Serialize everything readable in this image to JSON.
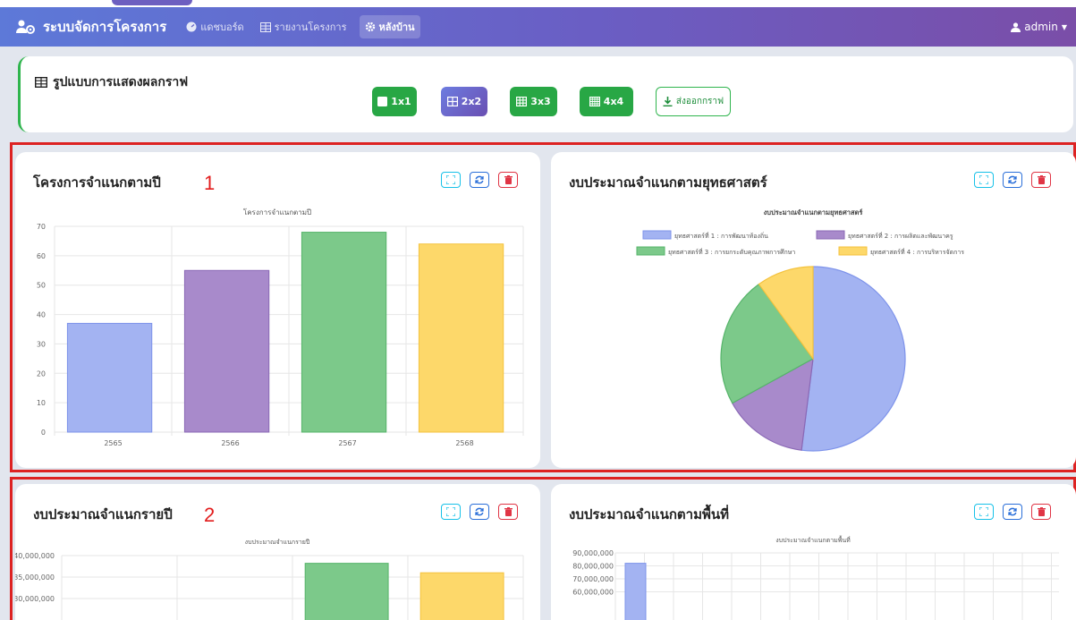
{
  "nav": {
    "brand": "ระบบจัดการโครงการ",
    "items": [
      {
        "label": "แดชบอร์ด",
        "icon": "dashboard-icon"
      },
      {
        "label": "รายงานโครงการ",
        "icon": "table-icon"
      },
      {
        "label": "หลังบ้าน",
        "icon": "gear-icon",
        "active": true
      }
    ],
    "user": "admin"
  },
  "layout_panel": {
    "title": "รูปแบบการแสดงผลกราฟ",
    "buttons": [
      {
        "label": "1x1",
        "style": "green"
      },
      {
        "label": "2x2",
        "style": "purple",
        "active": true
      },
      {
        "label": "3x3",
        "style": "green"
      },
      {
        "label": "4x4",
        "style": "green"
      }
    ],
    "export_label": "ส่งออกกราฟ"
  },
  "annotations": [
    "1",
    "2"
  ],
  "colors": {
    "blue": "#a3b3f2",
    "purple": "#a88acb",
    "green": "#7cc98a",
    "yellow": "#fdd86a",
    "accent_red": "#dd2222"
  },
  "cards": [
    {
      "title": "โครงการจำแนกตามปี"
    },
    {
      "title": "งบประมาณจำแนกตามยุทธศาสตร์"
    },
    {
      "title": "งบประมาณจำแนกรายปี"
    },
    {
      "title": "งบประมาณจำแนกตามพื้นที่"
    }
  ],
  "chart_data": [
    {
      "type": "bar",
      "title": "โครงการจำแนกตามปี",
      "categories": [
        "2565",
        "2566",
        "2567",
        "2568"
      ],
      "values": [
        37,
        55,
        68,
        64
      ],
      "ylim": [
        0,
        70
      ],
      "yticks": [
        "0",
        "10",
        "20",
        "30",
        "40",
        "50",
        "60",
        "70"
      ],
      "grid": true
    },
    {
      "type": "pie",
      "title": "งบประมาณจำแนกตามยุทธศาสตร์",
      "legend": "top",
      "labels": [
        "ยุทธศาสตร์ที่ 1 : การพัฒนาท้องถิ่น",
        "ยุทธศาสตร์ที่ 2 : การผลิตและพัฒนาครู",
        "ยุทธศาสตร์ที่ 3 : การยกระดับคุณภาพการศึกษา",
        "ยุทธศาสตร์ที่ 4 : การบริหารจัดการ"
      ],
      "values": [
        52,
        15,
        23,
        10
      ]
    },
    {
      "type": "bar",
      "title": "งบประมาณจำแนกรายปี",
      "yticks": [
        "40,000,000",
        "35,000,000",
        "30,000,000"
      ],
      "visible_values": [
        38200000,
        36000000
      ]
    },
    {
      "type": "bar",
      "title": "งบประมาณจำแนกตามพื้นที่",
      "yticks": [
        "90,000,000",
        "80,000,000",
        "70,000,000",
        "60,000,000"
      ],
      "visible_values": [
        82000000
      ]
    }
  ]
}
